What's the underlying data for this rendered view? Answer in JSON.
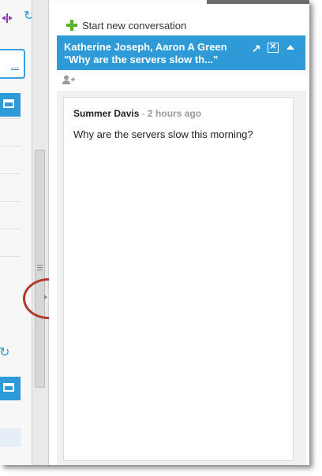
{
  "left_panel": {
    "link_text": "...",
    "icons": [
      "pin-icon",
      "window-icon",
      "refresh-icon"
    ]
  },
  "chat": {
    "new_conversation_label": "Start new conversation",
    "conversation": {
      "participants": "Katherine Joseph, Aaron A Green",
      "subject": "\"Why are the servers slow th...\"",
      "popout_glyph": "↗",
      "close_glyph": "✕"
    },
    "messages": [
      {
        "author": "Summer Davis",
        "separator": " - ",
        "time": "2 hours ago",
        "body": "Why are the servers slow this morning?"
      }
    ]
  },
  "colors": {
    "accent": "#2f9ad8",
    "add_green": "#5cb032",
    "annotation_circle": "#b23b2c"
  }
}
